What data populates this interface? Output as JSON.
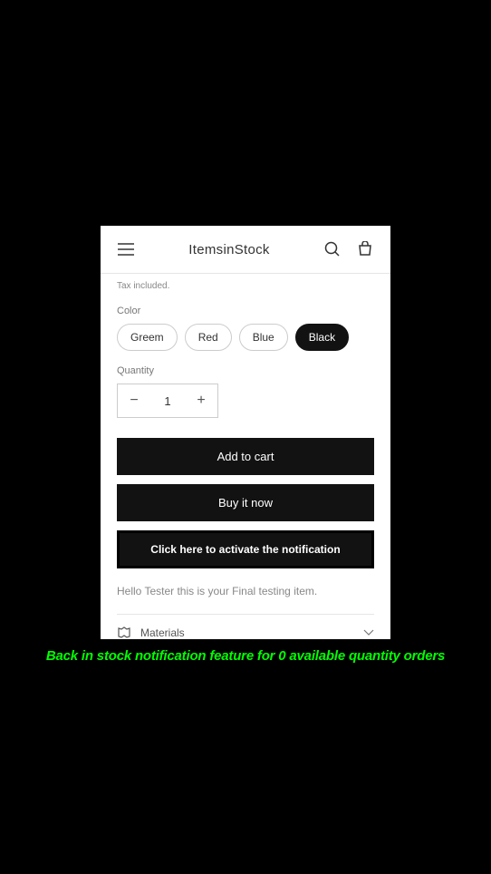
{
  "header": {
    "title": "ItemsinStock"
  },
  "product": {
    "tax_note": "Tax included.",
    "color_label": "Color",
    "colors": {
      "0": "Greem",
      "1": "Red",
      "2": "Blue",
      "3": "Black"
    },
    "quantity_label": "Quantity",
    "quantity_value": "1",
    "add_to_cart": "Add to cart",
    "buy_now": "Buy it now",
    "notify": "Click here to activate the notification",
    "description": "Hello Tester this is your Final testing item.",
    "materials_label": "Materials"
  },
  "caption": "Back in stock notification feature for 0 available quantity orders"
}
